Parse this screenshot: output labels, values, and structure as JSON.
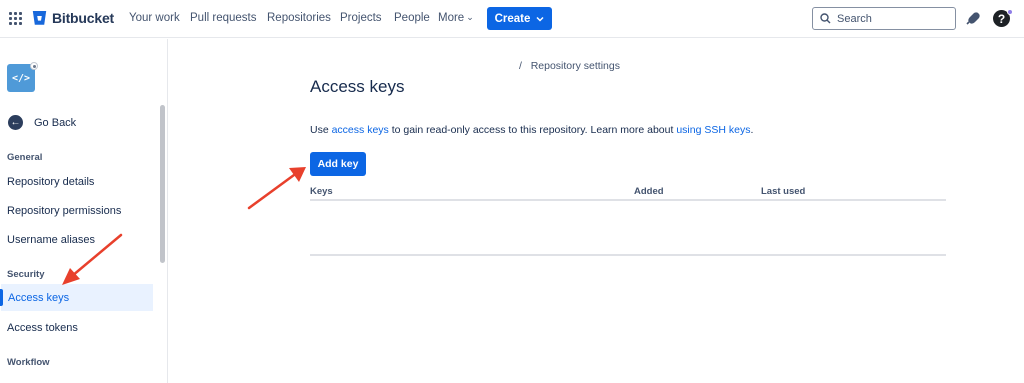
{
  "header": {
    "app_name": "Bitbucket",
    "nav": [
      "Your work",
      "Pull requests",
      "Repositories",
      "Projects",
      "People"
    ],
    "more_label": "More",
    "create_label": "Create",
    "search_placeholder": "Search",
    "help_label": "?"
  },
  "sidebar": {
    "repo_avatar_glyph": "</>",
    "go_back": "Go Back",
    "sections": {
      "general": "General",
      "security": "Security",
      "workflow": "Workflow"
    },
    "items": {
      "repository_details": "Repository details",
      "repository_permissions": "Repository permissions",
      "username_aliases": "Username aliases",
      "access_keys": "Access keys",
      "access_tokens": "Access tokens"
    },
    "active_item": "Access keys"
  },
  "main": {
    "breadcrumb_separator": "/",
    "breadcrumb": "Repository settings",
    "title": "Access keys",
    "description": {
      "prefix": "Use ",
      "link1": "access keys",
      "middle": " to gain read-only access to this repository. Learn more about ",
      "link2": "using SSH keys",
      "suffix": "."
    },
    "add_button": "Add key",
    "table": {
      "columns": [
        "Keys",
        "Added",
        "Last used"
      ],
      "rows": []
    }
  },
  "colors": {
    "primary": "#0c66e4",
    "annotation_arrow": "#e8402c",
    "active_bg": "#e9f2ff"
  }
}
